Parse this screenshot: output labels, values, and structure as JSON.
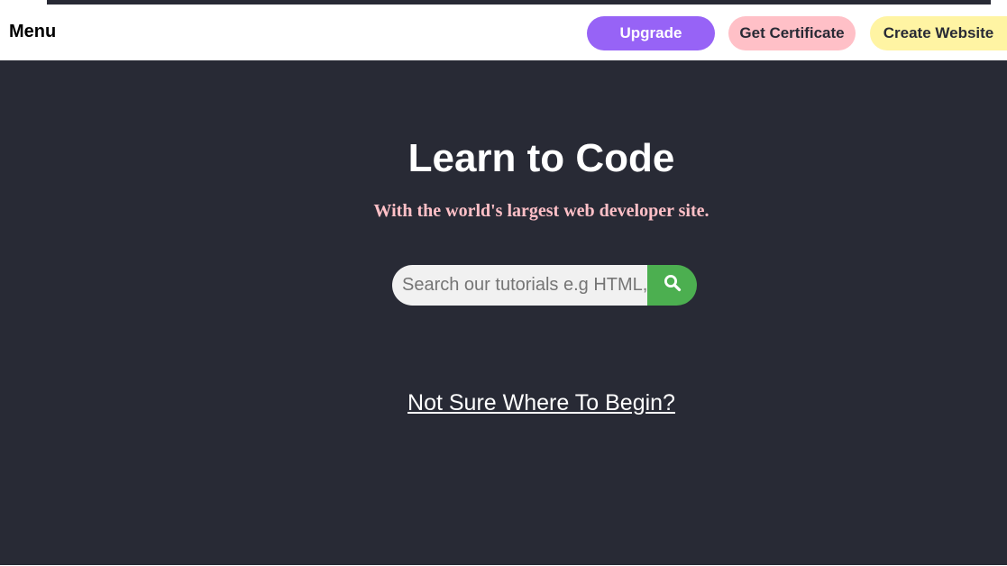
{
  "nav": {
    "menu_label": "Menu",
    "upgrade_label": "Upgrade",
    "certificate_label": "Get Certificate",
    "website_label": "Create Website"
  },
  "hero": {
    "title": "Learn to Code",
    "subtitle": "With the world's largest web developer site.",
    "search": {
      "placeholder": "Search our tutorials e.g HTML,",
      "value": "",
      "button_icon": "search-icon"
    },
    "begin_link": "Not Sure Where To Begin?"
  },
  "colors": {
    "hero_bg": "#282a35",
    "upgrade": "#9763f6",
    "certificate": "#ffc0c7",
    "website": "#fff4a3",
    "search_button": "#4caf50",
    "subtitle": "#ffc0c7"
  }
}
